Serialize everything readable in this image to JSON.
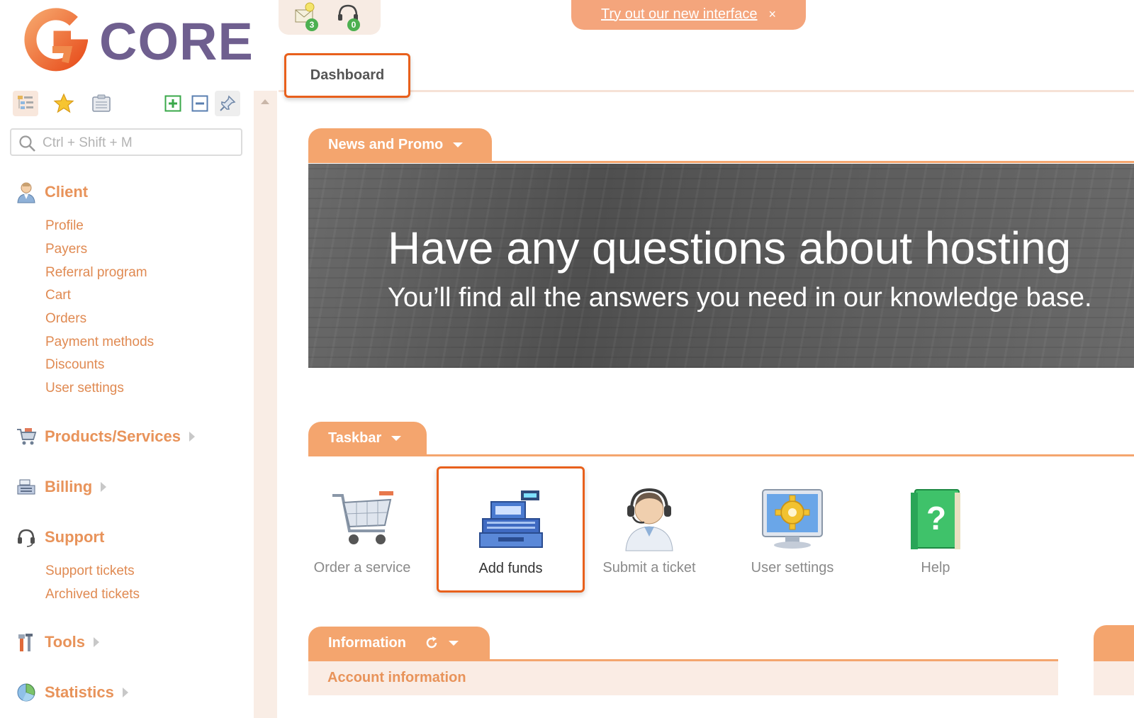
{
  "brand": {
    "name": "CORE"
  },
  "sidebar": {
    "search_placeholder": "Ctrl + Shift + M",
    "sections": [
      {
        "label": "Client",
        "icon": "user-icon",
        "items": [
          "Profile",
          "Payers",
          "Referral program",
          "Cart",
          "Orders",
          "Payment methods",
          "Discounts",
          "User settings"
        ]
      },
      {
        "label": "Products/Services",
        "icon": "cart-icon",
        "items": []
      },
      {
        "label": "Billing",
        "icon": "cash-register-icon",
        "items": []
      },
      {
        "label": "Support",
        "icon": "headset-icon",
        "items": [
          "Support tickets",
          "Archived tickets"
        ]
      },
      {
        "label": "Tools",
        "icon": "tools-icon",
        "items": []
      },
      {
        "label": "Statistics",
        "icon": "pie-chart-icon",
        "items": []
      }
    ]
  },
  "top": {
    "notifications": {
      "messages_count": "3",
      "support_count": "0"
    },
    "promo_text": "Try out our new interface",
    "promo_close": "×"
  },
  "tabs": {
    "dashboard": "Dashboard"
  },
  "panels": {
    "news": {
      "title": "News and Promo",
      "headline": "Have any questions about hosting",
      "subline": "You’ll find all the answers you need in our knowledge base."
    },
    "taskbar": {
      "title": "Taskbar",
      "items": [
        {
          "label": "Order a service",
          "icon": "shopping-cart-icon"
        },
        {
          "label": "Add funds",
          "icon": "cash-register-icon"
        },
        {
          "label": "Submit a ticket",
          "icon": "support-agent-icon"
        },
        {
          "label": "User settings",
          "icon": "monitor-gear-icon"
        },
        {
          "label": "Help",
          "icon": "help-book-icon"
        }
      ]
    },
    "information": {
      "title": "Information",
      "account_heading": "Account information"
    }
  },
  "colors": {
    "accent": "#f4a56e",
    "highlight_border": "#e8601c",
    "sidebar_text": "#e08a52",
    "logo_text": "#6f5f8f"
  }
}
